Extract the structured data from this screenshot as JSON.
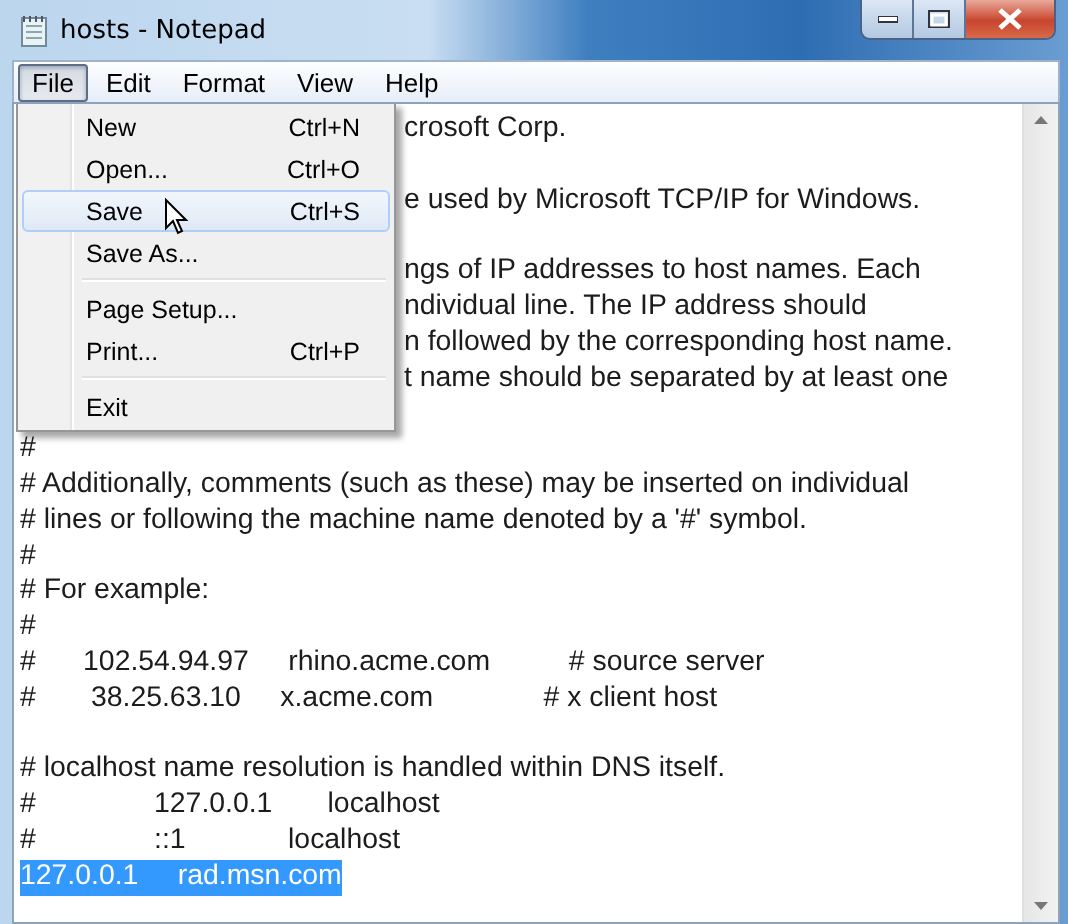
{
  "window": {
    "title": "hosts - Notepad"
  },
  "menu_bar": [
    {
      "label": "File",
      "selected": true
    },
    {
      "label": "Edit",
      "selected": false
    },
    {
      "label": "Format",
      "selected": false
    },
    {
      "label": "View",
      "selected": false
    },
    {
      "label": "Help",
      "selected": false
    }
  ],
  "file_menu": [
    {
      "kind": "item",
      "label": "New",
      "shortcut": "Ctrl+N",
      "selected": false
    },
    {
      "kind": "item",
      "label": "Open...",
      "shortcut": "Ctrl+O",
      "selected": false
    },
    {
      "kind": "item",
      "label": "Save",
      "shortcut": "Ctrl+S",
      "selected": true
    },
    {
      "kind": "item",
      "label": "Save As...",
      "selected": false
    },
    {
      "kind": "separator"
    },
    {
      "kind": "item",
      "label": "Page Setup...",
      "selected": false
    },
    {
      "kind": "item",
      "label": "Print...",
      "shortcut": "Ctrl+P",
      "selected": false
    },
    {
      "kind": "separator"
    },
    {
      "kind": "item",
      "label": "Exit",
      "selected": false
    }
  ],
  "editor": {
    "lines": [
      {
        "kind": "covered",
        "text": "crosoft Corp."
      },
      {
        "kind": "blank"
      },
      {
        "kind": "covered",
        "text": "e used by Microsoft TCP/IP for Windows."
      },
      {
        "kind": "blank"
      },
      {
        "kind": "covered",
        "text": "ngs of IP addresses to host names. Each"
      },
      {
        "kind": "covered",
        "text": "ndividual line. The IP address should"
      },
      {
        "kind": "covered",
        "text": "n followed by the corresponding host name."
      },
      {
        "kind": "covered",
        "text": "t name should be separated by at least one"
      },
      {
        "kind": "blank"
      },
      {
        "kind": "full",
        "text": "#"
      },
      {
        "kind": "full",
        "text": "# Additionally, comments (such as these) may be inserted on individual"
      },
      {
        "kind": "full",
        "text": "# lines or following the machine name denoted by a '#' symbol."
      },
      {
        "kind": "full",
        "text": "#"
      },
      {
        "kind": "full",
        "text": "# For example:"
      },
      {
        "kind": "full",
        "text": "#"
      },
      {
        "kind": "full",
        "text": "#      102.54.94.97     rhino.acme.com          # source server"
      },
      {
        "kind": "full",
        "text": "#       38.25.63.10     x.acme.com              # x client host"
      },
      {
        "kind": "blank"
      },
      {
        "kind": "full",
        "text": "# localhost name resolution is handled within DNS itself."
      },
      {
        "kind": "full",
        "text": "#               127.0.0.1       localhost"
      },
      {
        "kind": "full",
        "text": "#               ::1             localhost"
      },
      {
        "kind": "selected",
        "text": "127.0.0.1     rad.msn.com"
      }
    ]
  }
}
